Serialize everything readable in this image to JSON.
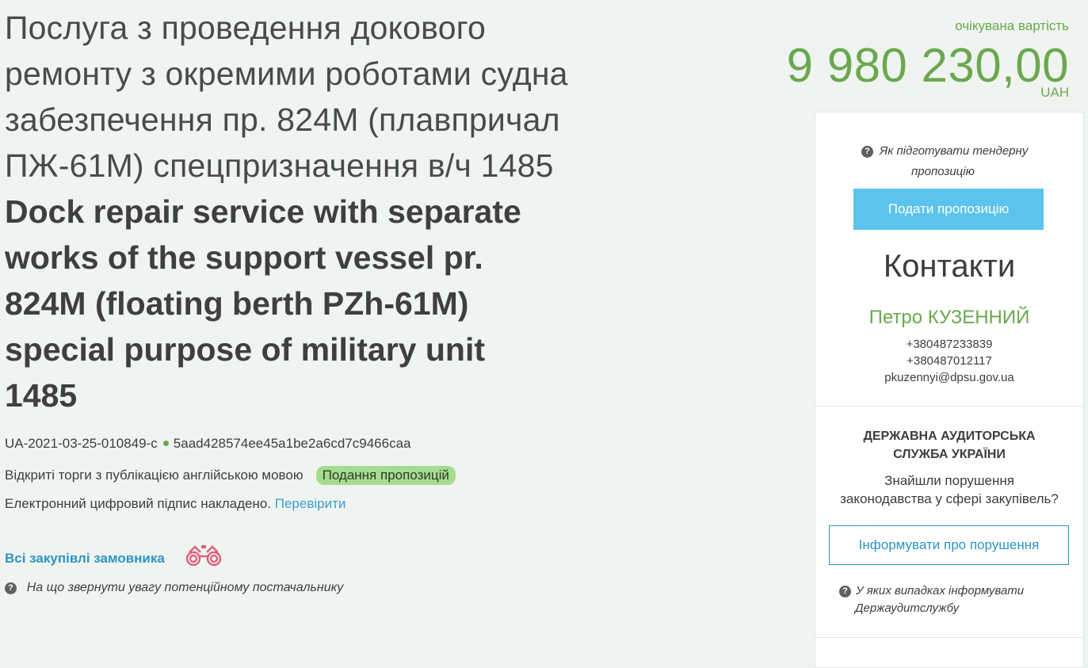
{
  "tender": {
    "title_ua_lines": [
      "Послуга з проведення докового",
      "ремонту з окремими роботами судна",
      "забезпечення пр. 824М (плавпричал",
      "ПЖ-61М) спецпризначення в/ч 1485"
    ],
    "title_en_lines": [
      "Dock repair service with separate",
      "works of the support vessel pr.",
      "824M (floating berth PZh-61M)",
      "special purpose of military unit",
      "1485"
    ],
    "tender_id": "UA-2021-03-25-010849-c",
    "hash": "5aad428574ee45a1be2a6cd7c9466caa",
    "procedure_type": "Відкриті торги з публікацією англійською мовою",
    "status_badge": "Подання пропозицій",
    "signature_text": "Електронний цифровий підпис накладено.",
    "verify_link": "Перевірити",
    "all_purchases_link": "Всі закупівлі замовника",
    "supplier_hint": "На що звернути увагу потенційному постачальнику"
  },
  "price": {
    "label": "очікувана вартість",
    "amount": "9 980 230,00",
    "currency": "UAH"
  },
  "sidebar": {
    "prep_hint_line1": "Як підготувати тендерну",
    "prep_hint_line2": "пропозицію",
    "submit_button": "Подати пропозицію",
    "contacts_title": "Контакти",
    "contact_name": "Петро КУЗЕННИЙ",
    "phone1": "+380487233839",
    "phone2": "+380487012117",
    "email": "pkuzennyi@dpsu.gov.ua",
    "audit_title_line1": "ДЕРЖАВНА АУДИТОРСЬКА",
    "audit_title_line2": "СЛУЖБА УКРАЇНИ",
    "audit_text_line1": "Знайшли порушення",
    "audit_text_line2": "законодавства у сфері закупівель?",
    "report_button": "Інформувати про порушення",
    "audit_hint_line1": "У яких випадках інформувати",
    "audit_hint_line2": "Держаудитслужбу"
  },
  "icons": {
    "question": "?",
    "binoculars_color": "#e0607a"
  },
  "colors": {
    "accent_green": "#6aa84f",
    "link_blue": "#2c95c4",
    "button_blue": "#5bc3ec",
    "badge_green": "#a6dc8f"
  }
}
